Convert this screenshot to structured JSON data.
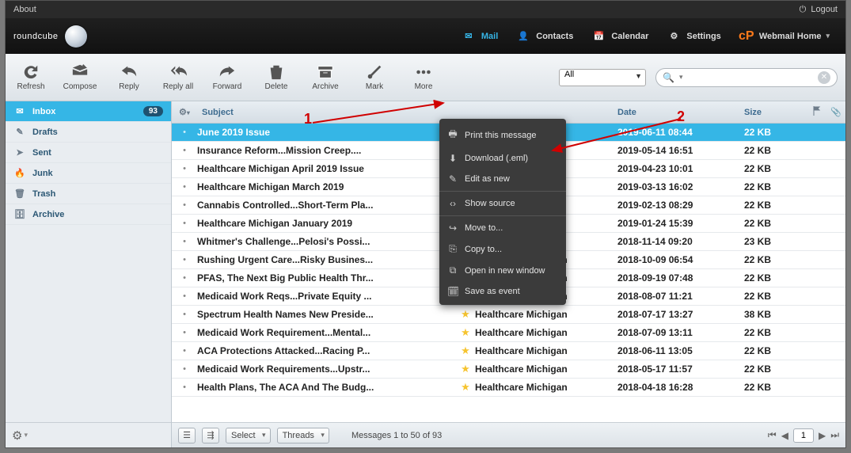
{
  "topbar": {
    "about": "About",
    "logout": "Logout"
  },
  "logo": "roundcube",
  "nav": [
    {
      "key": "mail",
      "label": "Mail",
      "active": true
    },
    {
      "key": "contacts",
      "label": "Contacts"
    },
    {
      "key": "calendar",
      "label": "Calendar"
    },
    {
      "key": "settings",
      "label": "Settings"
    },
    {
      "key": "webmail-home",
      "label": "Webmail Home"
    }
  ],
  "toolbar": [
    {
      "key": "refresh",
      "label": "Refresh"
    },
    {
      "key": "compose",
      "label": "Compose"
    },
    {
      "key": "reply",
      "label": "Reply"
    },
    {
      "key": "replyall",
      "label": "Reply all"
    },
    {
      "key": "forward",
      "label": "Forward"
    },
    {
      "key": "delete",
      "label": "Delete"
    },
    {
      "key": "archive",
      "label": "Archive"
    },
    {
      "key": "mark",
      "label": "Mark"
    },
    {
      "key": "more",
      "label": "More"
    }
  ],
  "filter": {
    "value": "All"
  },
  "folders": [
    {
      "key": "inbox",
      "label": "Inbox",
      "badge": "93",
      "active": true
    },
    {
      "key": "drafts",
      "label": "Drafts"
    },
    {
      "key": "sent",
      "label": "Sent"
    },
    {
      "key": "junk",
      "label": "Junk"
    },
    {
      "key": "trash",
      "label": "Trash"
    },
    {
      "key": "archive",
      "label": "Archive"
    }
  ],
  "columns": {
    "subject": "Subject",
    "date": "Date",
    "size": "Size"
  },
  "messages": [
    {
      "subject": "June 2019 Issue",
      "from": "",
      "date": "2019-06-11 08:44",
      "size": "22 KB",
      "star": false,
      "selected": true
    },
    {
      "subject": "Insurance Reform...Mission Creep....",
      "from": "",
      "date": "2019-05-14 16:51",
      "size": "22 KB",
      "star": false
    },
    {
      "subject": "Healthcare Michigan April 2019 Issue",
      "from": "",
      "date": "2019-04-23 10:01",
      "size": "22 KB",
      "star": false
    },
    {
      "subject": "Healthcare Michigan March 2019",
      "from": "",
      "date": "2019-03-13 16:02",
      "size": "22 KB",
      "star": false
    },
    {
      "subject": "Cannabis Controlled...Short-Term Pla...",
      "from": "",
      "date": "2019-02-13 08:29",
      "size": "22 KB",
      "star": false
    },
    {
      "subject": "Healthcare Michigan January 2019",
      "from": "",
      "date": "2019-01-24 15:39",
      "size": "22 KB",
      "star": false
    },
    {
      "subject": "Whitmer's Challenge...Pelosi's Possi...",
      "from": "",
      "date": "2018-11-14 09:20",
      "size": "23 KB",
      "star": false
    },
    {
      "subject": "Rushing Urgent Care...Risky Busines...",
      "from": "Healthcare Michigan",
      "date": "2018-10-09 06:54",
      "size": "22 KB",
      "star": true
    },
    {
      "subject": "PFAS, The Next Big Public Health Thr...",
      "from": "Healthcare Michigan",
      "date": "2018-09-19 07:48",
      "size": "22 KB",
      "star": true
    },
    {
      "subject": "Medicaid Work Reqs...Private Equity ...",
      "from": "Healthcare Michigan",
      "date": "2018-08-07 11:21",
      "size": "22 KB",
      "star": true
    },
    {
      "subject": "Spectrum Health Names New Preside...",
      "from": "Healthcare Michigan",
      "date": "2018-07-17 13:27",
      "size": "38 KB",
      "star": true
    },
    {
      "subject": "Medicaid Work Requirement...Mental...",
      "from": "Healthcare Michigan",
      "date": "2018-07-09 13:11",
      "size": "22 KB",
      "star": true
    },
    {
      "subject": "ACA Protections Attacked...Racing P...",
      "from": "Healthcare Michigan",
      "date": "2018-06-11 13:05",
      "size": "22 KB",
      "star": true
    },
    {
      "subject": "Medicaid Work Requirements...Upstr...",
      "from": "Healthcare Michigan",
      "date": "2018-05-17 11:57",
      "size": "22 KB",
      "star": true
    },
    {
      "subject": "Health Plans, The ACA And The Budg...",
      "from": "Healthcare Michigan",
      "date": "2018-04-18 16:28",
      "size": "22 KB",
      "star": true
    }
  ],
  "menu": [
    {
      "key": "print",
      "label": "Print this message"
    },
    {
      "key": "download",
      "label": "Download (.eml)"
    },
    {
      "key": "editnew",
      "label": "Edit as new"
    },
    {
      "sep": true
    },
    {
      "key": "source",
      "label": "Show source"
    },
    {
      "sep": true
    },
    {
      "key": "moveto",
      "label": "Move to..."
    },
    {
      "key": "copyto",
      "label": "Copy to..."
    },
    {
      "key": "newwin",
      "label": "Open in new window"
    },
    {
      "key": "saveevent",
      "label": "Save as event"
    }
  ],
  "footer": {
    "select": "Select",
    "threads": "Threads",
    "status": "Messages 1 to 50 of 93",
    "page": "1"
  },
  "annotations": {
    "one": "1",
    "two": "2"
  }
}
